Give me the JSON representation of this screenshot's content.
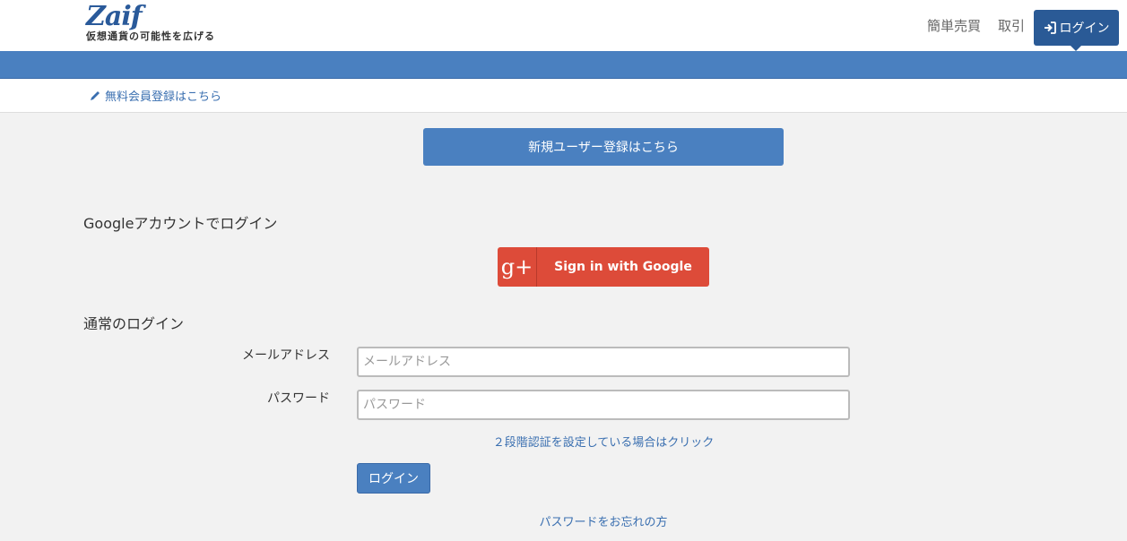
{
  "header": {
    "logo_text": "Zaif",
    "logo_tagline": "仮想通貨の可能性を広げる",
    "nav_simple_trade": "簡単売買",
    "nav_trade": "取引",
    "nav_login": "ログイン",
    "login_icon": "sign-in-icon"
  },
  "subbar": {
    "register_link": "無料会員登録はこちら",
    "register_icon": "pencil-icon"
  },
  "main": {
    "signup_button": "新規ユーザー登録はこちら",
    "google_section_title": "Googleアカウントでログイン",
    "google_button_label": "Sign in with Google",
    "google_icon_glyph": "g+",
    "normal_section_title": "通常のログイン",
    "email_label": "メールアドレス",
    "email_placeholder": "メールアドレス",
    "email_value": "",
    "password_label": "パスワード",
    "password_placeholder": "パスワード",
    "password_value": "",
    "two_factor_link": "２段階認証を設定している場合はクリック",
    "login_button": "ログイン",
    "forgot_password_link": "パスワードをお忘れの方"
  },
  "colors": {
    "brand_blue": "#4a80c0",
    "nav_login_bg": "#2a5a96",
    "google_red": "#dd4b39",
    "link_blue": "#3a6fb0"
  }
}
